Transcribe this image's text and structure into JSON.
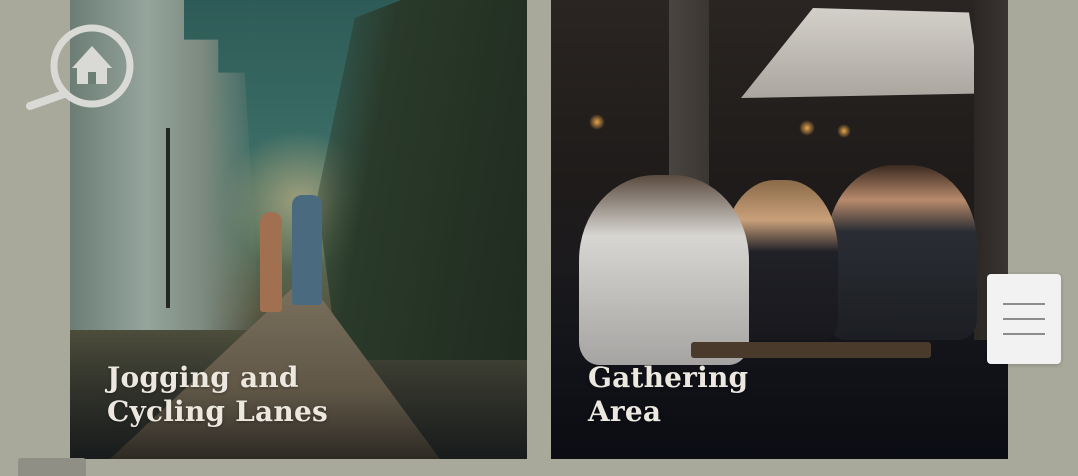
{
  "cards": [
    {
      "title_lines": [
        "Jogging and",
        "Cycling Lanes"
      ]
    },
    {
      "title_lines": [
        "Gathering",
        "Area"
      ]
    }
  ],
  "icons": {
    "home_search": "home-search-icon",
    "menu": "hamburger-menu-icon"
  },
  "colors": {
    "page_background": "#a9a99b",
    "caption_text": "#ece8e0",
    "menu_button_bg": "#f2f2f2",
    "menu_bar": "#8d8d8d",
    "icon_stroke": "#d9d9d6"
  }
}
